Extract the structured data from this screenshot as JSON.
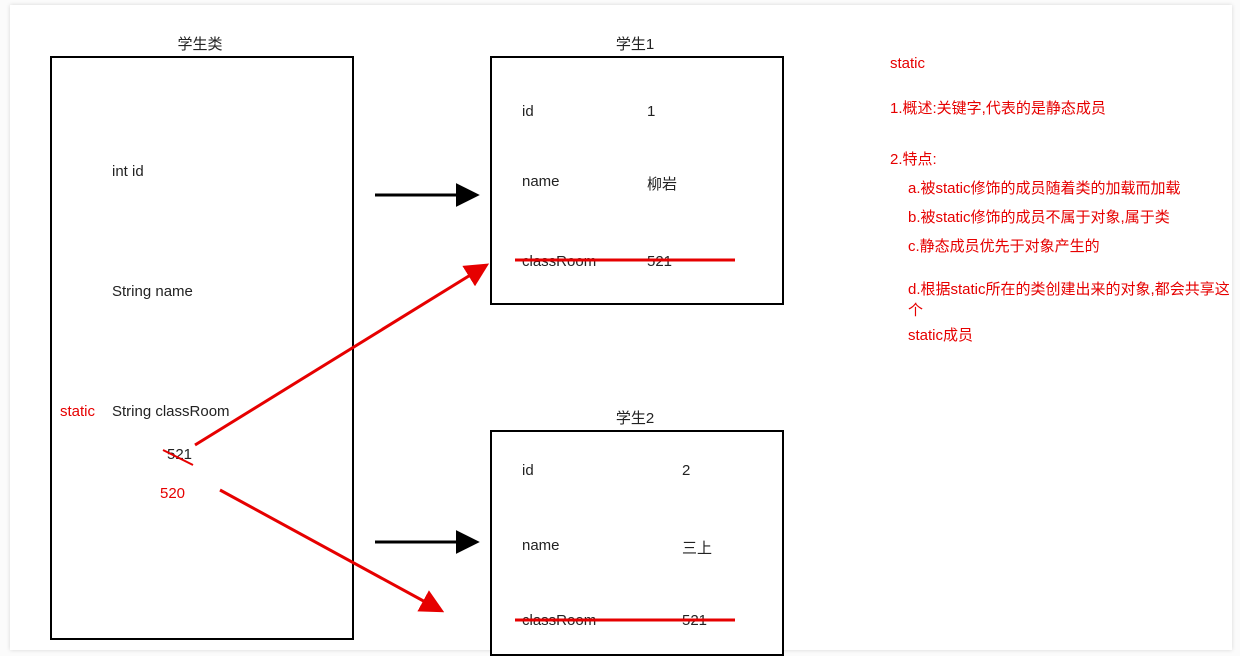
{
  "class_box": {
    "title": "学生类",
    "field_id": "int id",
    "field_name": "String name",
    "static_label": "static",
    "field_classroom": "String classRoom",
    "value_521": "521",
    "value_520": "520"
  },
  "student1": {
    "title": "学生1",
    "id_label": "id",
    "id_value": "1",
    "name_label": "name",
    "name_value": "柳岩",
    "classroom_label": "classRoom",
    "classroom_value": "521"
  },
  "student2": {
    "title": "学生2",
    "id_label": "id",
    "id_value": "2",
    "name_label": "name",
    "name_value": "三上",
    "classroom_label": "classRoom",
    "classroom_value": "521"
  },
  "notes": {
    "heading": "static",
    "line1": "1.概述:关键字,代表的是静态成员",
    "line2_title": "2.特点:",
    "line2_a": "a.被static修饰的成员随着类的加载而加载",
    "line2_b": "b.被static修饰的成员不属于对象,属于类",
    "line2_c": "c.静态成员优先于对象产生的",
    "line2_d1": "d.根据static所在的类创建出来的对象,都会共享这个",
    "line2_d2": "static成员"
  }
}
